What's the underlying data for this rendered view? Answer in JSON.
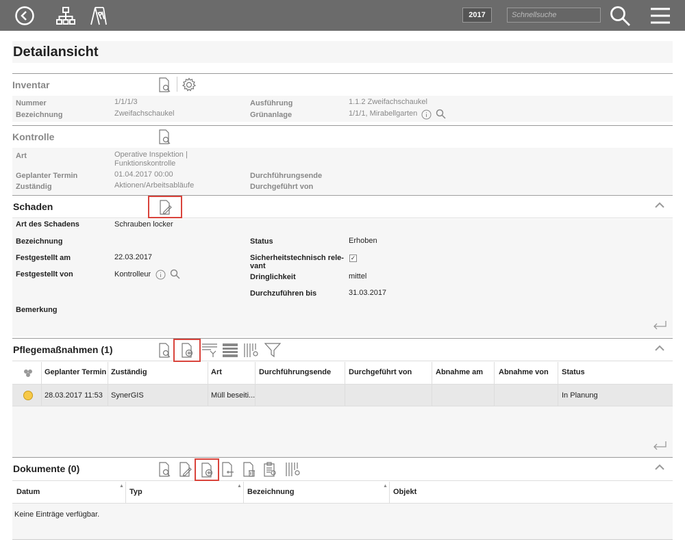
{
  "topbar": {
    "year": "2017",
    "search_placeholder": "Schnellsuche",
    "icons": [
      "back-icon",
      "hierarchy-icon",
      "playground-icon",
      "search-icon",
      "menu-icon"
    ]
  },
  "page_title": "Detailansicht",
  "inventar": {
    "title": "Inventar",
    "nummer_label": "Nummer",
    "nummer_value": "1/1/1/3",
    "bezeichnung_label": "Bezeichnung",
    "bezeichnung_value": "Zweifachschaukel",
    "ausfuehrung_label": "Ausführung",
    "ausfuehrung_value": "1.1.2 Zweifachschaukel",
    "gruenanlage_label": "Grünanlage",
    "gruenanlage_value": "1/1/1, Mirabellgarten"
  },
  "kontrolle": {
    "title": "Kontrolle",
    "art_label": "Art",
    "art_value_1": "Operative Inspektion |",
    "art_value_2": "Funktionskontrolle",
    "termin_label": "Geplanter Termin",
    "termin_value": "01.04.2017 00:00",
    "zustaendig_label": "Zuständig",
    "zustaendig_value": "Aktionen/Arbeitsabläufe",
    "durchfuehrungsende_label": "Durchführungsende",
    "durchgefuehrt_label": "Durchgeführt von"
  },
  "schaden": {
    "title": "Schaden",
    "art_label": "Art des Schadens",
    "art_value": "Schrauben locker",
    "bezeichnung_label": "Bezeichnung",
    "festgestellt_am_label": "Festgestellt am",
    "festgestellt_am_value": "22.03.2017",
    "festgestellt_von_label": "Festgestellt von",
    "festgestellt_von_value": "Kontrolleur",
    "bemerkung_label": "Bemerkung",
    "status_label": "Status",
    "status_value": "Erhoben",
    "sicherheit_label_1": "Sicherheitstechnisch rele-",
    "sicherheit_label_2": "vant",
    "dringlichkeit_label": "Dringlichkeit",
    "dringlichkeit_value": "mittel",
    "bis_label": "Durchzuführen bis",
    "bis_value": "31.03.2017"
  },
  "pflege": {
    "title": "Pflegemaßnahmen (1)",
    "columns": [
      "Geplanter Termin",
      "Zuständig",
      "Art",
      "Durchführungsende",
      "Durchgeführt von",
      "Abnahme am",
      "Abnahme von",
      "Status"
    ],
    "row": {
      "termin": "28.03.2017 11:53",
      "zustaendig": "SynerGIS",
      "art": "Müll beseiti...",
      "status": "In Planung"
    }
  },
  "dokumente": {
    "title": "Dokumente (0)",
    "columns": [
      "Datum",
      "Typ",
      "Bezeichnung",
      "Objekt"
    ],
    "empty": "Keine Einträge verfügbar."
  },
  "colors": {
    "topbar": "#6b6b6b",
    "highlight": "#d9433b",
    "status_dot": "#f7c948"
  }
}
